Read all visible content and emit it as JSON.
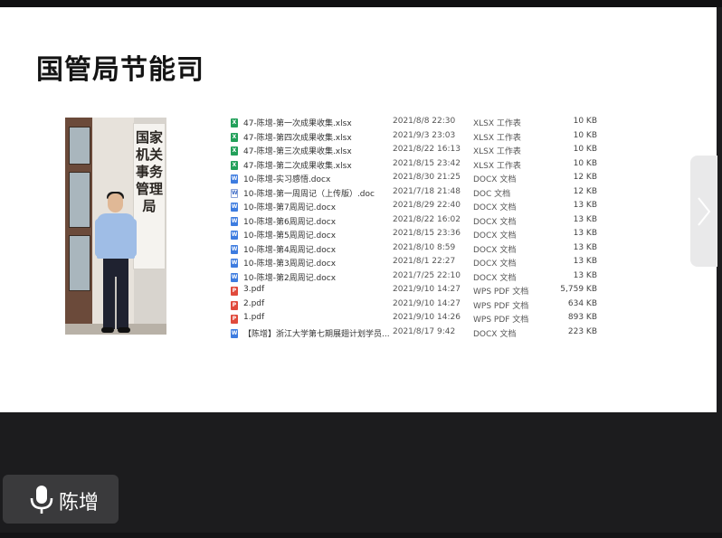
{
  "slide": {
    "title": "国管局节能司",
    "plaque_text": "国家机关事务管理局"
  },
  "files": [
    {
      "name": "47-陈增-第一次成果收集.xlsx",
      "date": "2021/8/8 22:30",
      "type": "XLSX 工作表",
      "size": "10 KB",
      "icon": "xlsx"
    },
    {
      "name": "47-陈增-第四次成果收集.xlsx",
      "date": "2021/9/3 23:03",
      "type": "XLSX 工作表",
      "size": "10 KB",
      "icon": "xlsx"
    },
    {
      "name": "47-陈增-第三次成果收集.xlsx",
      "date": "2021/8/22 16:13",
      "type": "XLSX 工作表",
      "size": "10 KB",
      "icon": "xlsx"
    },
    {
      "name": "47-陈增-第二次成果收集.xlsx",
      "date": "2021/8/15 23:42",
      "type": "XLSX 工作表",
      "size": "10 KB",
      "icon": "xlsx"
    },
    {
      "name": "10-陈增-实习感悟.docx",
      "date": "2021/8/30 21:25",
      "type": "DOCX 文档",
      "size": "12 KB",
      "icon": "docx"
    },
    {
      "name": "10-陈增-第一周周记（上传版）.doc",
      "date": "2021/7/18 21:48",
      "type": "DOC 文档",
      "size": "12 KB",
      "icon": "doc"
    },
    {
      "name": "10-陈增-第7周周记.docx",
      "date": "2021/8/29 22:40",
      "type": "DOCX 文档",
      "size": "13 KB",
      "icon": "docx"
    },
    {
      "name": "10-陈增-第6周周记.docx",
      "date": "2021/8/22 16:02",
      "type": "DOCX 文档",
      "size": "13 KB",
      "icon": "docx"
    },
    {
      "name": "10-陈增-第5周周记.docx",
      "date": "2021/8/15 23:36",
      "type": "DOCX 文档",
      "size": "13 KB",
      "icon": "docx"
    },
    {
      "name": "10-陈增-第4周周记.docx",
      "date": "2021/8/10 8:59",
      "type": "DOCX 文档",
      "size": "13 KB",
      "icon": "docx"
    },
    {
      "name": "10-陈增-第3周周记.docx",
      "date": "2021/8/1 22:27",
      "type": "DOCX 文档",
      "size": "13 KB",
      "icon": "docx"
    },
    {
      "name": "10-陈增-第2周周记.docx",
      "date": "2021/7/25 22:10",
      "type": "DOCX 文档",
      "size": "13 KB",
      "icon": "docx"
    },
    {
      "name": "3.pdf",
      "date": "2021/9/10 14:27",
      "type": "WPS PDF 文档",
      "size": "5,759 KB",
      "icon": "pdf"
    },
    {
      "name": "2.pdf",
      "date": "2021/9/10 14:27",
      "type": "WPS PDF 文档",
      "size": "634 KB",
      "icon": "pdf"
    },
    {
      "name": "1.pdf",
      "date": "2021/9/10 14:26",
      "type": "WPS PDF 文档",
      "size": "893 KB",
      "icon": "pdf"
    },
    {
      "name": "【陈增】浙江大学第七期展翅计划学员...",
      "date": "2021/8/17 9:42",
      "type": "DOCX 文档",
      "size": "223 KB",
      "icon": "docx"
    }
  ],
  "speaker": {
    "name": "陈增",
    "icon": "microphone-icon"
  },
  "navigation": {
    "next_icon": "chevron-right-icon"
  }
}
